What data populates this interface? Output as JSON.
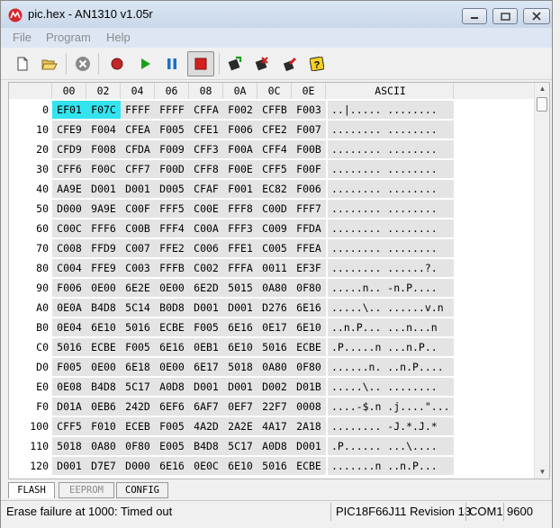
{
  "window": {
    "title": "pic.hex - AN1310 v1.05r",
    "controls": {
      "minimize": "—",
      "maximize": "□",
      "close": "✕"
    }
  },
  "menu": [
    {
      "label": "File"
    },
    {
      "label": "Program"
    },
    {
      "label": "Help"
    }
  ],
  "toolbar": {
    "icons": [
      "new-file-icon",
      "open-folder-icon",
      "cancel-icon",
      "record-icon",
      "run-icon",
      "pause-icon",
      "stop-icon",
      "write-device-icon",
      "erase-device-icon",
      "verify-device-icon",
      "help-icon"
    ],
    "stop_pressed": true
  },
  "grid": {
    "columns": [
      "00",
      "02",
      "04",
      "06",
      "08",
      "0A",
      "0C",
      "0E"
    ],
    "ascii_header": "ASCII",
    "rows": [
      {
        "addr": "0",
        "words": [
          "EF01",
          "F07C",
          "FFFF",
          "FFFF",
          "CFFA",
          "F002",
          "CFFB",
          "F003"
        ],
        "ascii": "..|..... ........"
      },
      {
        "addr": "10",
        "words": [
          "CFE9",
          "F004",
          "CFEA",
          "F005",
          "CFE1",
          "F006",
          "CFE2",
          "F007"
        ],
        "ascii": "........ ........"
      },
      {
        "addr": "20",
        "words": [
          "CFD9",
          "F008",
          "CFDA",
          "F009",
          "CFF3",
          "F00A",
          "CFF4",
          "F00B"
        ],
        "ascii": "........ ........"
      },
      {
        "addr": "30",
        "words": [
          "CFF6",
          "F00C",
          "CFF7",
          "F00D",
          "CFF8",
          "F00E",
          "CFF5",
          "F00F"
        ],
        "ascii": "........ ........"
      },
      {
        "addr": "40",
        "words": [
          "AA9E",
          "D001",
          "D001",
          "D005",
          "CFAF",
          "F001",
          "EC82",
          "F006"
        ],
        "ascii": "........ ........"
      },
      {
        "addr": "50",
        "words": [
          "D000",
          "9A9E",
          "C00F",
          "FFF5",
          "C00E",
          "FFF8",
          "C00D",
          "FFF7"
        ],
        "ascii": "........ ........"
      },
      {
        "addr": "60",
        "words": [
          "C00C",
          "FFF6",
          "C00B",
          "FFF4",
          "C00A",
          "FFF3",
          "C009",
          "FFDA"
        ],
        "ascii": "........ ........"
      },
      {
        "addr": "70",
        "words": [
          "C008",
          "FFD9",
          "C007",
          "FFE2",
          "C006",
          "FFE1",
          "C005",
          "FFEA"
        ],
        "ascii": "........ ........"
      },
      {
        "addr": "80",
        "words": [
          "C004",
          "FFE9",
          "C003",
          "FFFB",
          "C002",
          "FFFA",
          "0011",
          "EF3F"
        ],
        "ascii": "........ ......?."
      },
      {
        "addr": "90",
        "words": [
          "F006",
          "0E00",
          "6E2E",
          "0E00",
          "6E2D",
          "5015",
          "0A80",
          "0F80"
        ],
        "ascii": ".....n.. -n.P...."
      },
      {
        "addr": "A0",
        "words": [
          "0E0A",
          "B4D8",
          "5C14",
          "B0D8",
          "D001",
          "D001",
          "D276",
          "6E16"
        ],
        "ascii": ".....\\.. ......v.n"
      },
      {
        "addr": "B0",
        "words": [
          "0E04",
          "6E10",
          "5016",
          "ECBE",
          "F005",
          "6E16",
          "0E17",
          "6E10"
        ],
        "ascii": "..n.P... ...n...n"
      },
      {
        "addr": "C0",
        "words": [
          "5016",
          "ECBE",
          "F005",
          "6E16",
          "0EB1",
          "6E10",
          "5016",
          "ECBE"
        ],
        "ascii": ".P.....n ...n.P.."
      },
      {
        "addr": "D0",
        "words": [
          "F005",
          "0E00",
          "6E18",
          "0E00",
          "6E17",
          "5018",
          "0A80",
          "0F80"
        ],
        "ascii": "......n. ..n.P...."
      },
      {
        "addr": "E0",
        "words": [
          "0E08",
          "B4D8",
          "5C17",
          "A0D8",
          "D001",
          "D001",
          "D002",
          "D01B"
        ],
        "ascii": ".....\\.. ........"
      },
      {
        "addr": "F0",
        "words": [
          "D01A",
          "0EB6",
          "242D",
          "6EF6",
          "6AF7",
          "0EF7",
          "22F7",
          "0008"
        ],
        "ascii": "....-$.n .j....\"..."
      },
      {
        "addr": "100",
        "words": [
          "CFF5",
          "F010",
          "ECEB",
          "F005",
          "4A2D",
          "2A2E",
          "4A17",
          "2A18"
        ],
        "ascii": "........ -J.*.J.*"
      },
      {
        "addr": "110",
        "words": [
          "5018",
          "0A80",
          "0F80",
          "E005",
          "B4D8",
          "5C17",
          "A0D8",
          "D001"
        ],
        "ascii": ".P...... ...\\...."
      },
      {
        "addr": "120",
        "words": [
          "D001",
          "D7E7",
          "D000",
          "6E16",
          "0E0C",
          "6E10",
          "5016",
          "ECBE"
        ],
        "ascii": ".......n ..n.P..."
      }
    ],
    "selected": [
      [
        0,
        0
      ],
      [
        0,
        1
      ]
    ]
  },
  "tabs": [
    {
      "label": "FLASH",
      "state": "active"
    },
    {
      "label": "EEPROM",
      "state": "disabled"
    },
    {
      "label": "CONFIG",
      "state": "normal"
    }
  ],
  "status": {
    "message": "Erase failure at 1000: Timed out",
    "device": "PIC18F66J11 Revision 13",
    "port": "COM1",
    "baud": "9600"
  },
  "colors": {
    "selection": "#33e4ef",
    "cell_bg": "#e4e4e4",
    "titlebar": "#cbd9ea"
  }
}
